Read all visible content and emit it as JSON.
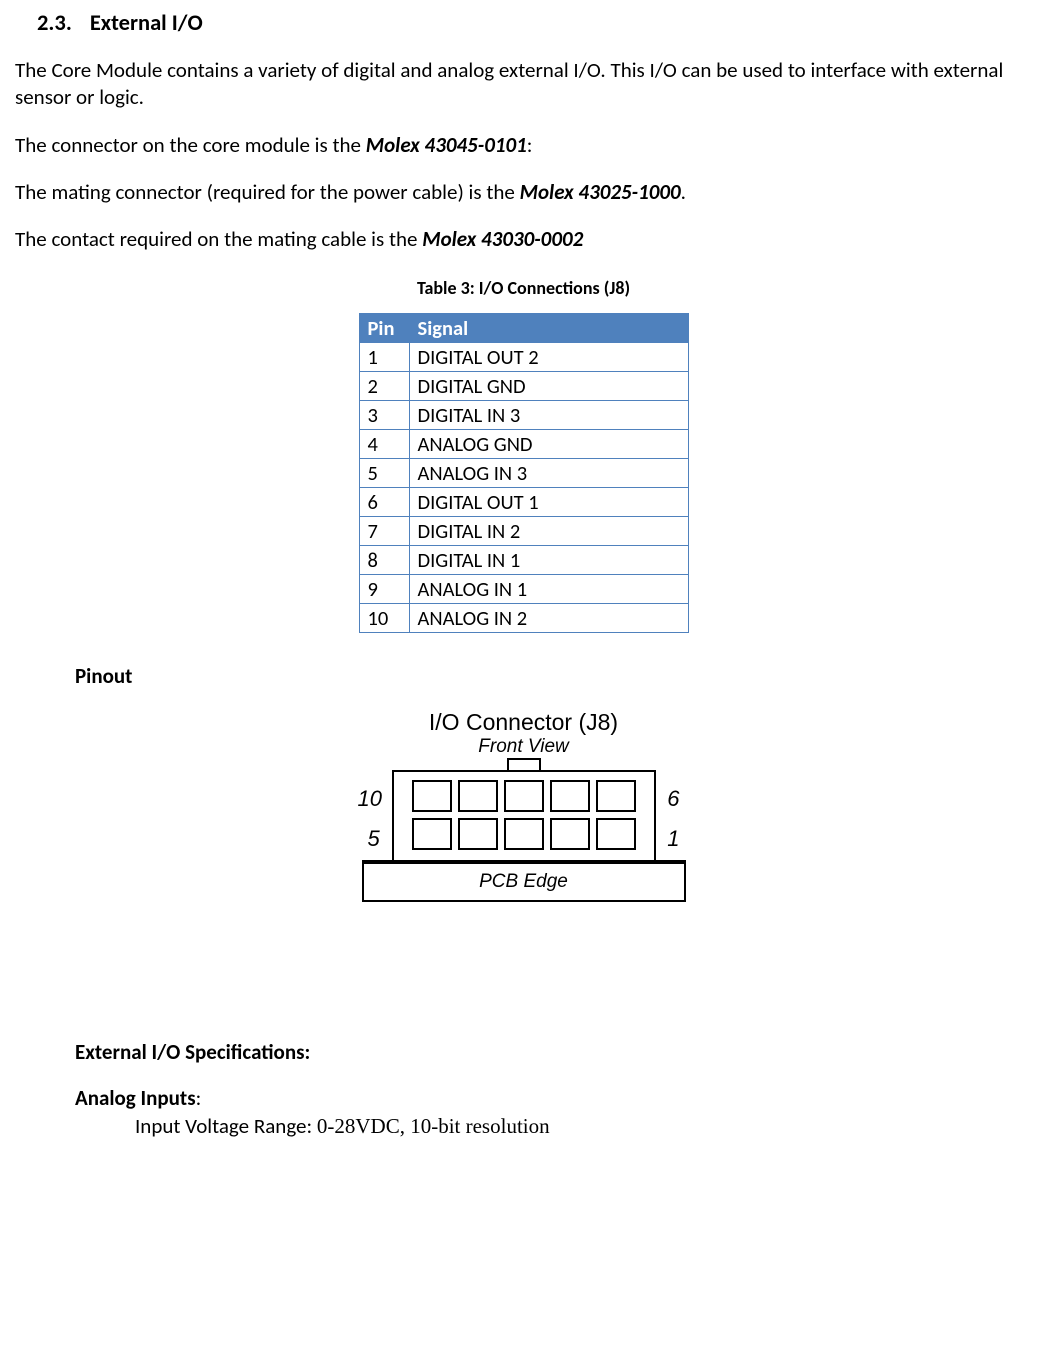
{
  "section": {
    "number": "2.3.",
    "title": "External I/O"
  },
  "para1": "The Core Module contains a variety of digital and analog external I/O.  This I/O can be used to interface with external sensor or logic.",
  "para2_pre": "The connector on the core module is the ",
  "para2_bold": "Molex 43045-0101",
  "para2_post": ":",
  "para3_pre": "The mating connector (required for the power cable) is the ",
  "para3_bold": "Molex 43025-1000",
  "para3_post": ".",
  "para4_pre": "The contact required on the mating cable is the ",
  "para4_bold": "Molex 43030-0002",
  "table_caption": "Table 3:  I/O Connections (J8)",
  "table": {
    "headers": {
      "pin": "Pin",
      "signal": "Signal"
    },
    "rows": [
      {
        "pin": "1",
        "signal": "DIGITAL OUT 2"
      },
      {
        "pin": "2",
        "signal": "DIGITAL GND"
      },
      {
        "pin": "3",
        "signal": "DIGITAL IN 3"
      },
      {
        "pin": "4",
        "signal": "ANALOG GND"
      },
      {
        "pin": "5",
        "signal": "ANALOG IN 3"
      },
      {
        "pin": "6",
        "signal": "DIGITAL OUT 1"
      },
      {
        "pin": "7",
        "signal": "DIGITAL IN 2"
      },
      {
        "pin": "8",
        "signal": "DIGITAL IN 1"
      },
      {
        "pin": "9",
        "signal": "ANALOG IN 1"
      },
      {
        "pin": "10",
        "signal": "ANALOG IN 2"
      }
    ]
  },
  "pinout_heading": "Pinout",
  "diagram": {
    "title": "I/O Connector (J8)",
    "subtitle": "Front View",
    "labels": {
      "tl": "10",
      "tr": "6",
      "bl": "5",
      "br": "1"
    },
    "pcb": "PCB Edge"
  },
  "specs_heading": "External I/O Specifications:",
  "analog_inputs_label": "Analog Inputs",
  "analog_inputs_colon": ":",
  "analog_range_label": "Input Voltage Range: ",
  "analog_range_value": "0-28VDC, 10-bit resolution"
}
